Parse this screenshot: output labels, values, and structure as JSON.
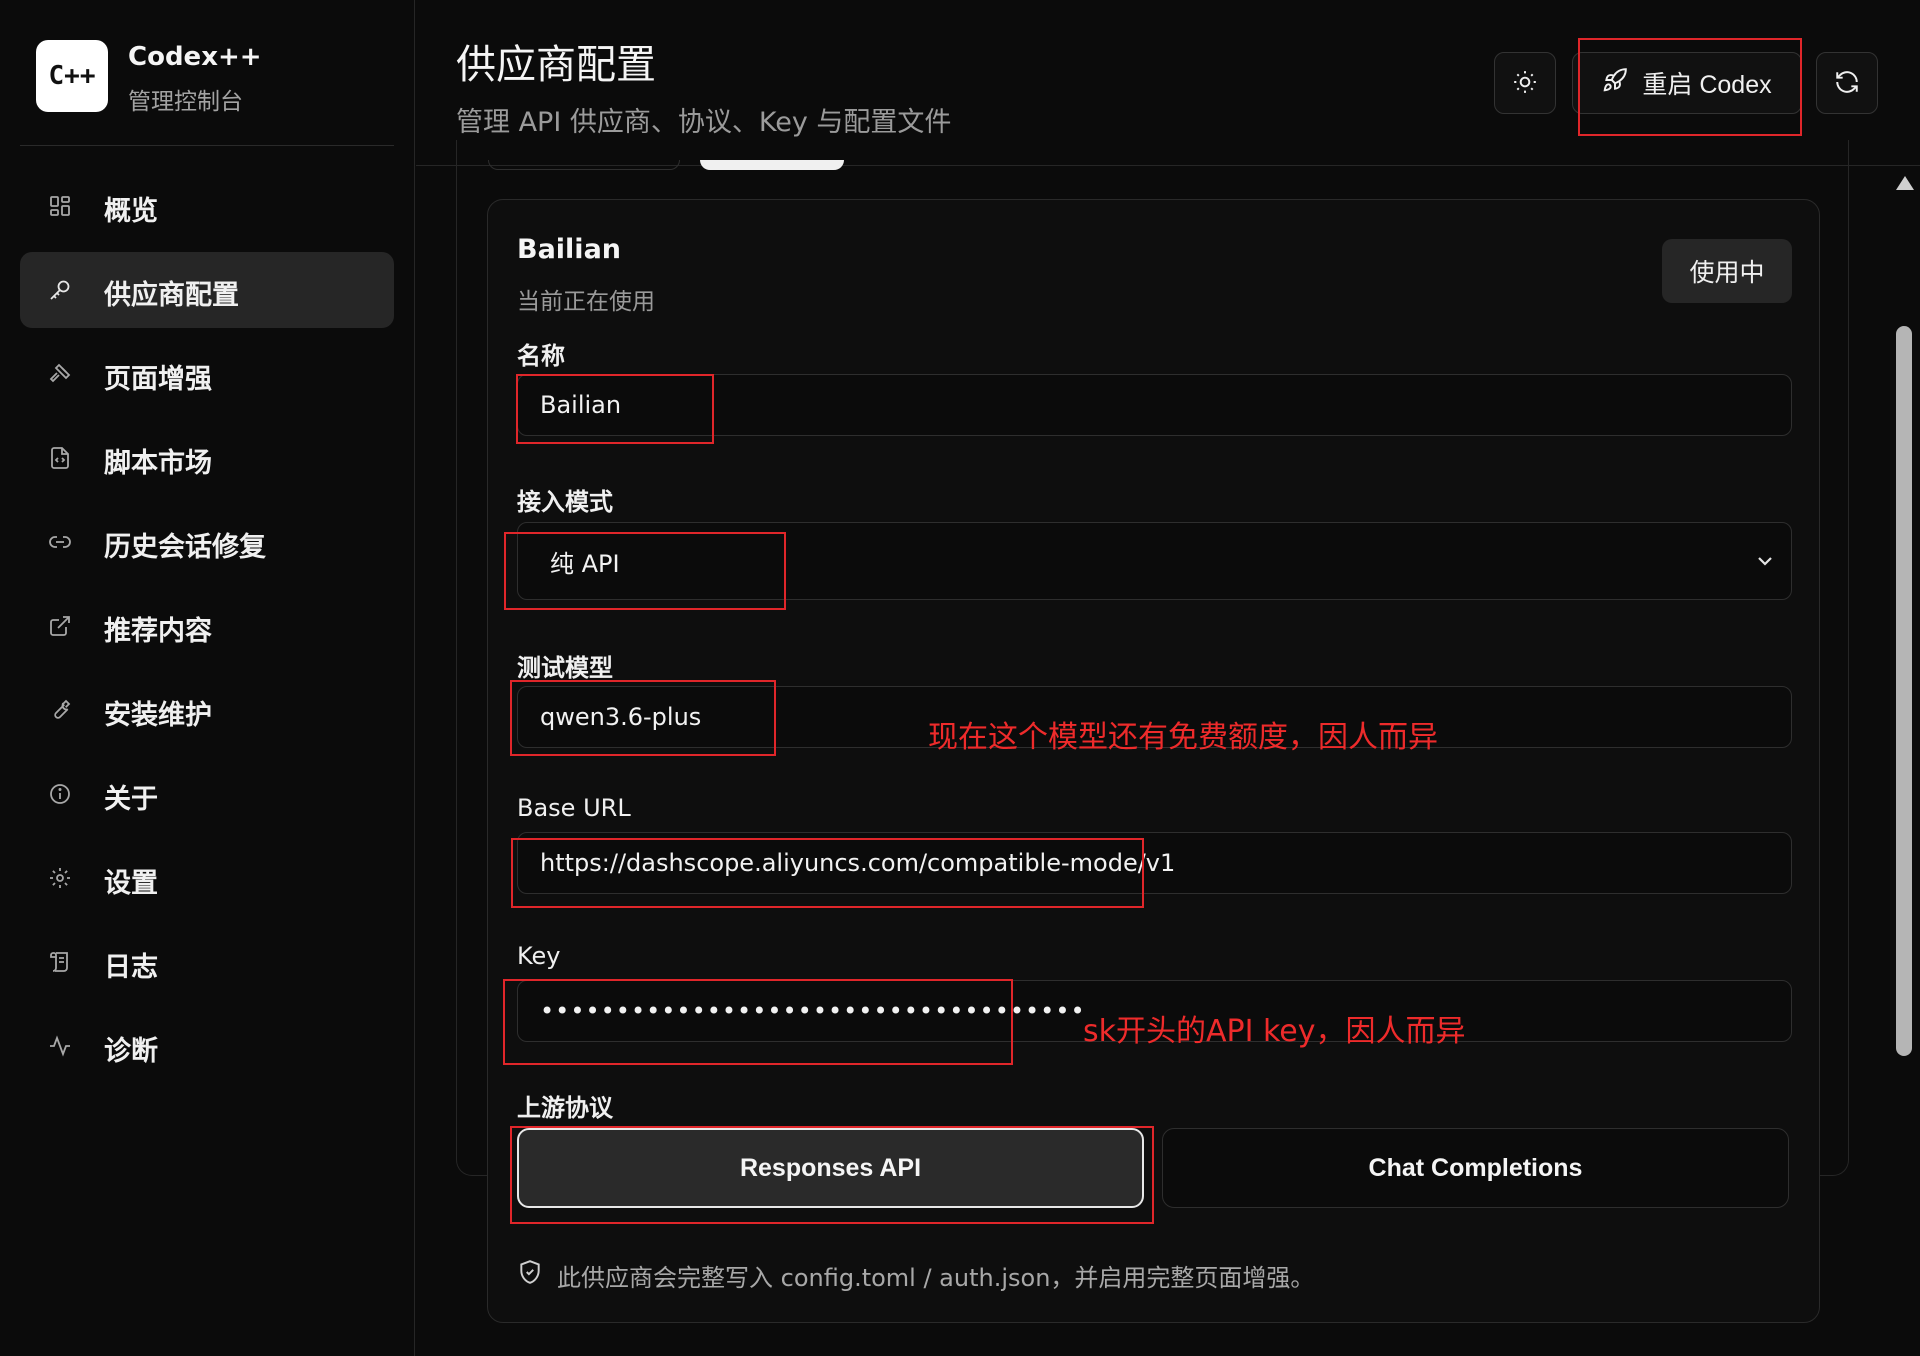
{
  "brand": {
    "logo_text": "C++",
    "name": "Codex++",
    "subtitle": "管理控制台"
  },
  "sidebar": {
    "items": [
      {
        "label": "概览",
        "icon": "dashboard-icon",
        "active": false
      },
      {
        "label": "供应商配置",
        "icon": "key-icon",
        "active": true
      },
      {
        "label": "页面增强",
        "icon": "hammer-icon",
        "active": false
      },
      {
        "label": "脚本市场",
        "icon": "file-code-icon",
        "active": false
      },
      {
        "label": "历史会话修复",
        "icon": "link-icon",
        "active": false
      },
      {
        "label": "推荐内容",
        "icon": "external-link-icon",
        "active": false
      },
      {
        "label": "安装维护",
        "icon": "wrench-icon",
        "active": false
      },
      {
        "label": "关于",
        "icon": "info-icon",
        "active": false
      },
      {
        "label": "设置",
        "icon": "gear-icon",
        "active": false
      },
      {
        "label": "日志",
        "icon": "scroll-icon",
        "active": false
      },
      {
        "label": "诊断",
        "icon": "activity-icon",
        "active": false
      }
    ]
  },
  "header": {
    "title": "供应商配置",
    "subtitle": "管理 API 供应商、协议、Key 与配置文件",
    "theme_icon": "sun-icon",
    "restart_label": "重启 Codex",
    "restart_icon": "rocket-icon",
    "refresh_icon": "refresh-icon"
  },
  "provider": {
    "title": "Bailian",
    "status": "当前正在使用",
    "badge": "使用中",
    "name_label": "名称",
    "name_value": "Bailian",
    "mode_label": "接入模式",
    "mode_value": "纯 API",
    "model_label": "测试模型",
    "model_value": "qwen3.6-plus",
    "base_url_label": "Base URL",
    "base_url_value": "https://dashscope.aliyuncs.com/compatible-mode/v1",
    "key_label": "Key",
    "key_value": "••••••••••••••••••••••••••••••••••••",
    "protocol_label": "上游协议",
    "protocol_options": [
      "Responses API",
      "Chat Completions"
    ],
    "protocol_selected": "Responses API",
    "footnote": "此供应商会完整写入 config.toml / auth.json，并启用完整页面增强。",
    "footnote_icon": "shield-check-icon"
  },
  "annotations": {
    "model_note": "现在这个模型还有免费额度，因人而异",
    "key_note": "sk开头的API key，因人而异",
    "color": "#e0262a"
  },
  "colors": {
    "background": "#0b0b0b",
    "active_nav": "#262626",
    "text": "#f2f2f2",
    "muted": "#9b9b9b"
  }
}
